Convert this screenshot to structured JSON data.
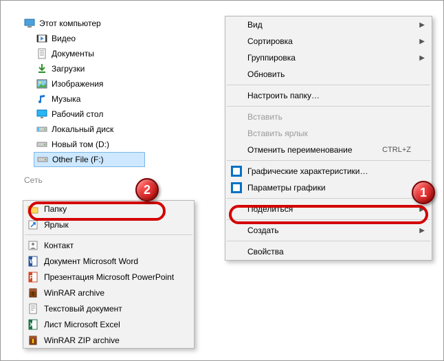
{
  "tree": {
    "items": [
      {
        "label": "Этот компьютер",
        "icon": "pc"
      },
      {
        "label": "Видео",
        "icon": "video"
      },
      {
        "label": "Документы",
        "icon": "docs"
      },
      {
        "label": "Загрузки",
        "icon": "downloads"
      },
      {
        "label": "Изображения",
        "icon": "images"
      },
      {
        "label": "Музыка",
        "icon": "music"
      },
      {
        "label": "Рабочий стол",
        "icon": "desktop"
      },
      {
        "label": "Локальный диск",
        "icon": "drive"
      },
      {
        "label": "Новый том (D:)",
        "icon": "drive"
      },
      {
        "label": "Other File (F:)",
        "icon": "drive",
        "selected": true
      }
    ],
    "network": "Сеть"
  },
  "context_main": {
    "view": "Вид",
    "sort": "Сортировка",
    "group": "Группировка",
    "refresh": "Обновить",
    "customize": "Настроить папку…",
    "paste": "Вставить",
    "paste_shortcut": "Вставить ярлык",
    "undo_rename": "Отменить переименование",
    "undo_kbd": "CTRL+Z",
    "gfx_props": "Графические характеристики…",
    "gfx_params": "Параметры графики",
    "share": "Поделиться",
    "create": "Создать",
    "properties": "Свойства"
  },
  "context_sub": {
    "folder": "Папку",
    "shortcut": "Ярлык",
    "contact": "Контакт",
    "word": "Документ Microsoft Word",
    "ppt": "Презентация Microsoft PowerPoint",
    "rar": "WinRAR archive",
    "txt": "Текстовый документ",
    "xls": "Лист Microsoft Excel",
    "zip": "WinRAR ZIP archive"
  },
  "badges": {
    "b1": "1",
    "b2": "2"
  }
}
